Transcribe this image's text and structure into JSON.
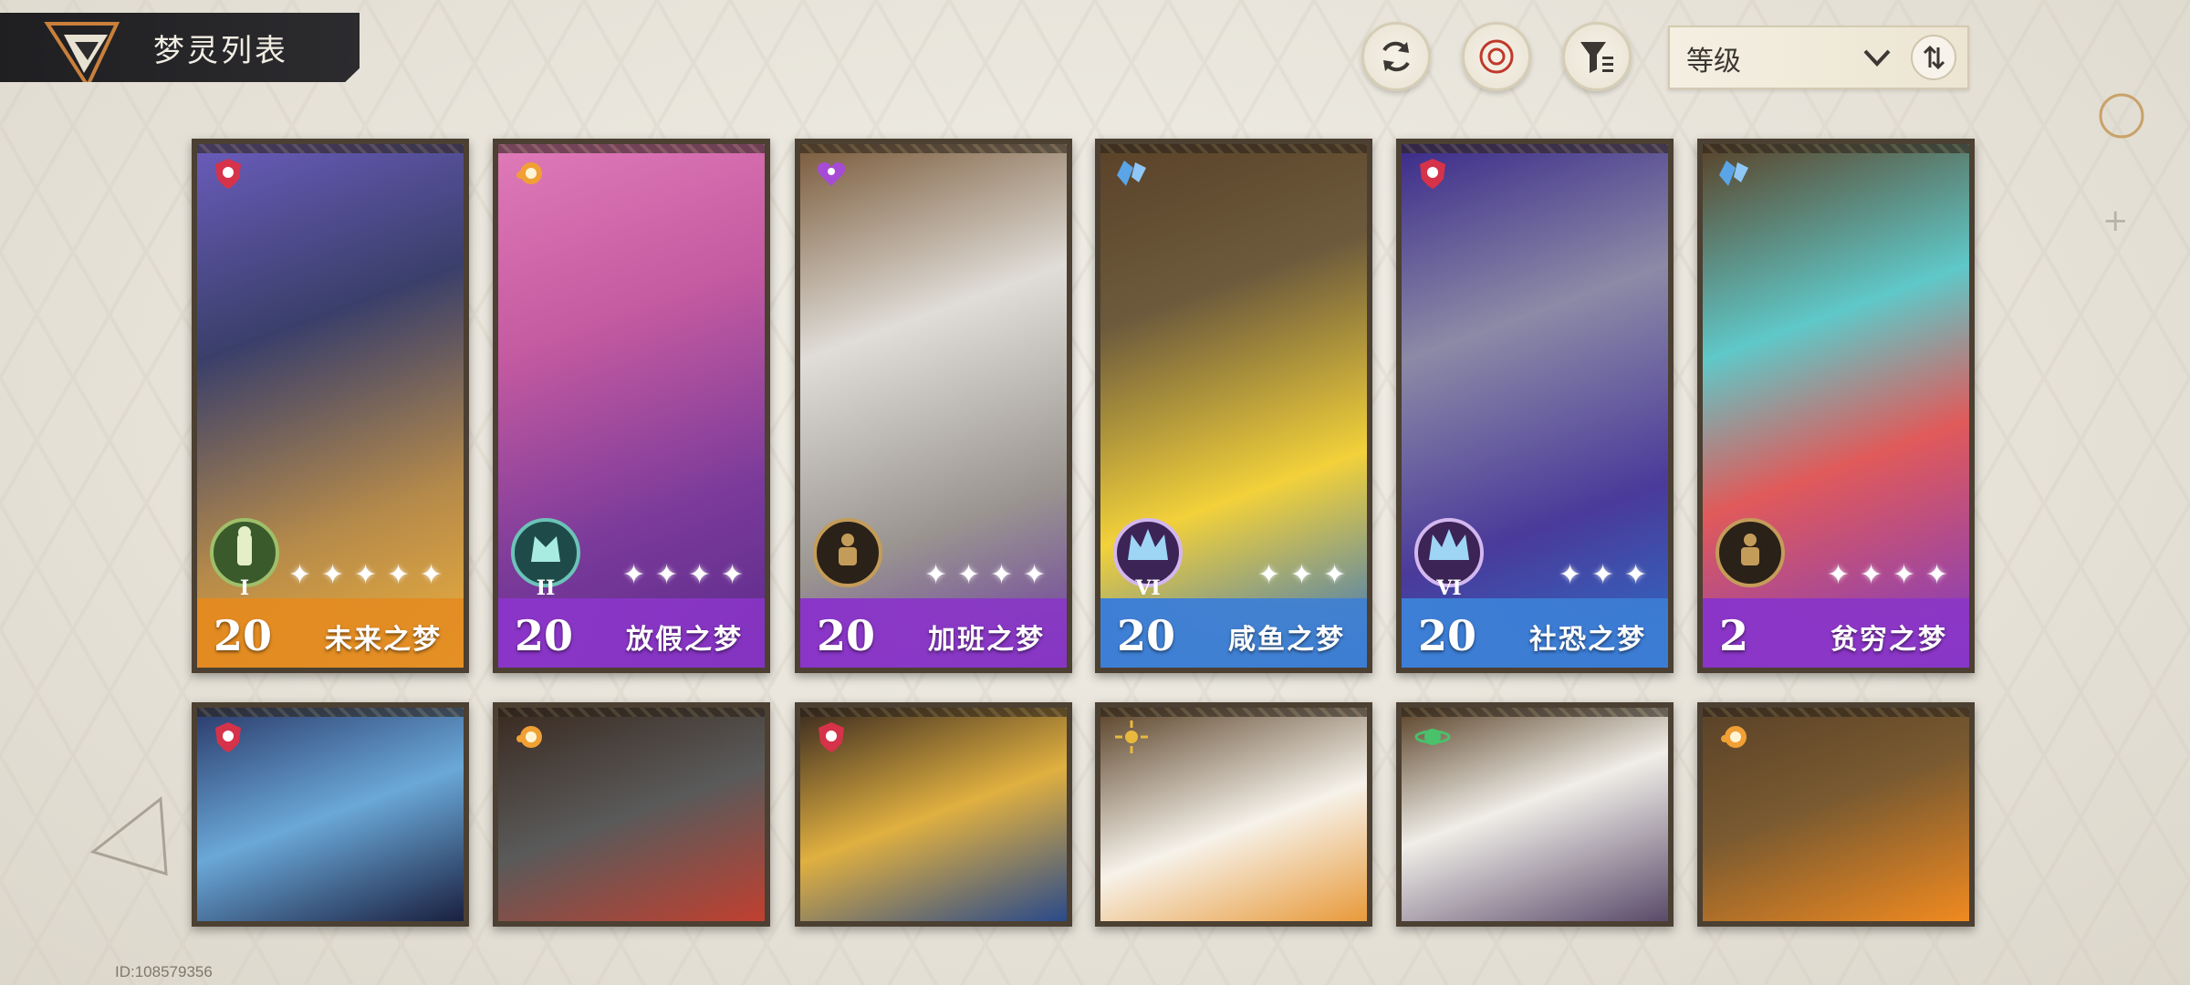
{
  "header": {
    "title": "梦灵列表"
  },
  "toolbar": {
    "refresh_icon": "refresh-icon",
    "target_icon": "target-icon",
    "filter_icon": "filter-icon",
    "sort_label": "等级",
    "sort_icon": "sort-order-icon"
  },
  "cards": [
    {
      "level": "20",
      "name": "未来之梦",
      "stars": 5,
      "rank": "I",
      "rank_style": "green",
      "element": "red-shield",
      "bar_color": "#e38b21"
    },
    {
      "level": "20",
      "name": "放假之梦",
      "stars": 4,
      "rank": "II",
      "rank_style": "teal",
      "element": "orange-orb",
      "bar_color": "#8a35c8"
    },
    {
      "level": "20",
      "name": "加班之梦",
      "stars": 4,
      "rank": "",
      "rank_style": "brown",
      "element": "purple-heart",
      "bar_color": "#8a35c8"
    },
    {
      "level": "20",
      "name": "咸鱼之梦",
      "stars": 3,
      "rank": "VI",
      "rank_style": "crown",
      "element": "blue-crystal",
      "bar_color": "#3d7fd6"
    },
    {
      "level": "20",
      "name": "社恐之梦",
      "stars": 3,
      "rank": "VI",
      "rank_style": "crown",
      "element": "red-shield",
      "bar_color": "#3d7fd6"
    },
    {
      "level": "2",
      "name": "贫穷之梦",
      "stars": 4,
      "rank": "",
      "rank_style": "brown",
      "element": "blue-crystal",
      "bar_color": "#8a35c8"
    }
  ],
  "cards_row2": [
    {
      "element": "red-shield"
    },
    {
      "element": "orange-orb"
    },
    {
      "element": "red-shield"
    },
    {
      "element": "gold-sun"
    },
    {
      "element": "green-planet"
    },
    {
      "element": "orange-orb"
    }
  ],
  "footer": {
    "uid": "ID:108579356"
  }
}
